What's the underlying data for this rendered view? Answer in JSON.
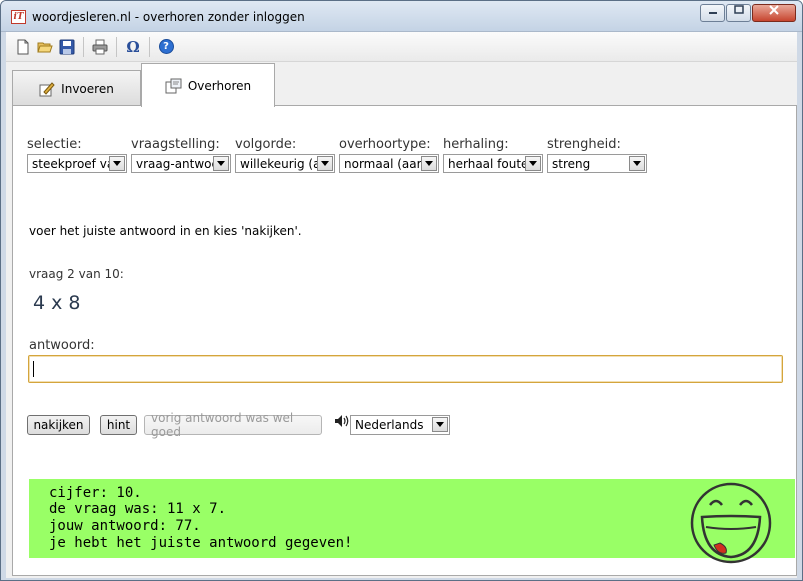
{
  "window": {
    "title": "woordjesleren.nl - overhoren zonder inloggen",
    "app_icon_text": "iT"
  },
  "toolbar": {
    "buttons": [
      "new-icon",
      "open-icon",
      "save-icon",
      "print-icon",
      "omega-icon",
      "help-icon"
    ],
    "omega_glyph": "Ω",
    "help_glyph": "?"
  },
  "tabs": [
    {
      "label": "Invoeren",
      "icon": "edit-icon",
      "active": false
    },
    {
      "label": "Overhoren",
      "icon": "quiz-icon",
      "active": true
    }
  ],
  "settings": {
    "selectie": {
      "label": "selectie:",
      "value": "steekproef va"
    },
    "vraagstelling": {
      "label": "vraagstelling:",
      "value": "vraag-antwoc"
    },
    "volgorde": {
      "label": "volgorde:",
      "value": "willekeurig (a"
    },
    "overhoortype": {
      "label": "overhoortype:",
      "value": "normaal (aar"
    },
    "herhaling": {
      "label": "herhaling:",
      "value": "herhaal foute"
    },
    "strengheid": {
      "label": "strengheid:",
      "value": "streng"
    }
  },
  "instruction": "voer het juiste antwoord in en kies 'nakijken'.",
  "question_counter": "vraag 2 van 10:",
  "question": "4 x 8",
  "answer": {
    "label": "antwoord:",
    "value": ""
  },
  "buttons": {
    "check": "nakijken",
    "hint": "hint",
    "previous_correct": "vorig antwoord was wel goed"
  },
  "language": {
    "value": "Nederlands"
  },
  "result": {
    "lines": [
      "cijfer: 10.",
      "de vraag was: 11 x 7.",
      "jouw antwoord: 77.",
      "je hebt het juiste antwoord gegeven!"
    ],
    "background_color": "#99ff66"
  },
  "colors": {
    "titlebar": "#c4d3e5",
    "result_bg": "#99ff66",
    "input_border": "#d4a53c"
  }
}
